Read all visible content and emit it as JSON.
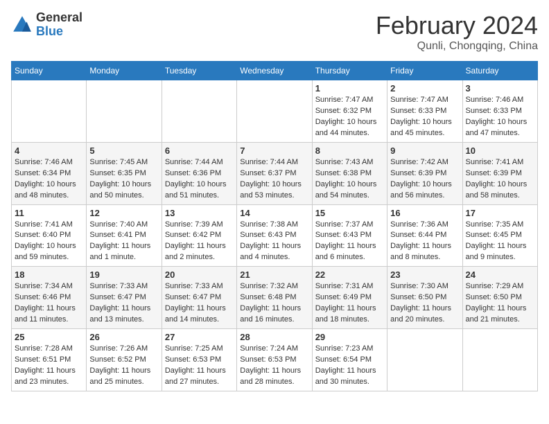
{
  "header": {
    "logo": {
      "general": "General",
      "blue": "Blue"
    },
    "title": "February 2024",
    "location": "Qunli, Chongqing, China"
  },
  "weekdays": [
    "Sunday",
    "Monday",
    "Tuesday",
    "Wednesday",
    "Thursday",
    "Friday",
    "Saturday"
  ],
  "weeks": [
    [
      {
        "day": "",
        "info": ""
      },
      {
        "day": "",
        "info": ""
      },
      {
        "day": "",
        "info": ""
      },
      {
        "day": "",
        "info": ""
      },
      {
        "day": "1",
        "info": "Sunrise: 7:47 AM\nSunset: 6:32 PM\nDaylight: 10 hours\nand 44 minutes."
      },
      {
        "day": "2",
        "info": "Sunrise: 7:47 AM\nSunset: 6:33 PM\nDaylight: 10 hours\nand 45 minutes."
      },
      {
        "day": "3",
        "info": "Sunrise: 7:46 AM\nSunset: 6:33 PM\nDaylight: 10 hours\nand 47 minutes."
      }
    ],
    [
      {
        "day": "4",
        "info": "Sunrise: 7:46 AM\nSunset: 6:34 PM\nDaylight: 10 hours\nand 48 minutes."
      },
      {
        "day": "5",
        "info": "Sunrise: 7:45 AM\nSunset: 6:35 PM\nDaylight: 10 hours\nand 50 minutes."
      },
      {
        "day": "6",
        "info": "Sunrise: 7:44 AM\nSunset: 6:36 PM\nDaylight: 10 hours\nand 51 minutes."
      },
      {
        "day": "7",
        "info": "Sunrise: 7:44 AM\nSunset: 6:37 PM\nDaylight: 10 hours\nand 53 minutes."
      },
      {
        "day": "8",
        "info": "Sunrise: 7:43 AM\nSunset: 6:38 PM\nDaylight: 10 hours\nand 54 minutes."
      },
      {
        "day": "9",
        "info": "Sunrise: 7:42 AM\nSunset: 6:39 PM\nDaylight: 10 hours\nand 56 minutes."
      },
      {
        "day": "10",
        "info": "Sunrise: 7:41 AM\nSunset: 6:39 PM\nDaylight: 10 hours\nand 58 minutes."
      }
    ],
    [
      {
        "day": "11",
        "info": "Sunrise: 7:41 AM\nSunset: 6:40 PM\nDaylight: 10 hours\nand 59 minutes."
      },
      {
        "day": "12",
        "info": "Sunrise: 7:40 AM\nSunset: 6:41 PM\nDaylight: 11 hours\nand 1 minute."
      },
      {
        "day": "13",
        "info": "Sunrise: 7:39 AM\nSunset: 6:42 PM\nDaylight: 11 hours\nand 2 minutes."
      },
      {
        "day": "14",
        "info": "Sunrise: 7:38 AM\nSunset: 6:43 PM\nDaylight: 11 hours\nand 4 minutes."
      },
      {
        "day": "15",
        "info": "Sunrise: 7:37 AM\nSunset: 6:43 PM\nDaylight: 11 hours\nand 6 minutes."
      },
      {
        "day": "16",
        "info": "Sunrise: 7:36 AM\nSunset: 6:44 PM\nDaylight: 11 hours\nand 8 minutes."
      },
      {
        "day": "17",
        "info": "Sunrise: 7:35 AM\nSunset: 6:45 PM\nDaylight: 11 hours\nand 9 minutes."
      }
    ],
    [
      {
        "day": "18",
        "info": "Sunrise: 7:34 AM\nSunset: 6:46 PM\nDaylight: 11 hours\nand 11 minutes."
      },
      {
        "day": "19",
        "info": "Sunrise: 7:33 AM\nSunset: 6:47 PM\nDaylight: 11 hours\nand 13 minutes."
      },
      {
        "day": "20",
        "info": "Sunrise: 7:33 AM\nSunset: 6:47 PM\nDaylight: 11 hours\nand 14 minutes."
      },
      {
        "day": "21",
        "info": "Sunrise: 7:32 AM\nSunset: 6:48 PM\nDaylight: 11 hours\nand 16 minutes."
      },
      {
        "day": "22",
        "info": "Sunrise: 7:31 AM\nSunset: 6:49 PM\nDaylight: 11 hours\nand 18 minutes."
      },
      {
        "day": "23",
        "info": "Sunrise: 7:30 AM\nSunset: 6:50 PM\nDaylight: 11 hours\nand 20 minutes."
      },
      {
        "day": "24",
        "info": "Sunrise: 7:29 AM\nSunset: 6:50 PM\nDaylight: 11 hours\nand 21 minutes."
      }
    ],
    [
      {
        "day": "25",
        "info": "Sunrise: 7:28 AM\nSunset: 6:51 PM\nDaylight: 11 hours\nand 23 minutes."
      },
      {
        "day": "26",
        "info": "Sunrise: 7:26 AM\nSunset: 6:52 PM\nDaylight: 11 hours\nand 25 minutes."
      },
      {
        "day": "27",
        "info": "Sunrise: 7:25 AM\nSunset: 6:53 PM\nDaylight: 11 hours\nand 27 minutes."
      },
      {
        "day": "28",
        "info": "Sunrise: 7:24 AM\nSunset: 6:53 PM\nDaylight: 11 hours\nand 28 minutes."
      },
      {
        "day": "29",
        "info": "Sunrise: 7:23 AM\nSunset: 6:54 PM\nDaylight: 11 hours\nand 30 minutes."
      },
      {
        "day": "",
        "info": ""
      },
      {
        "day": "",
        "info": ""
      }
    ]
  ]
}
